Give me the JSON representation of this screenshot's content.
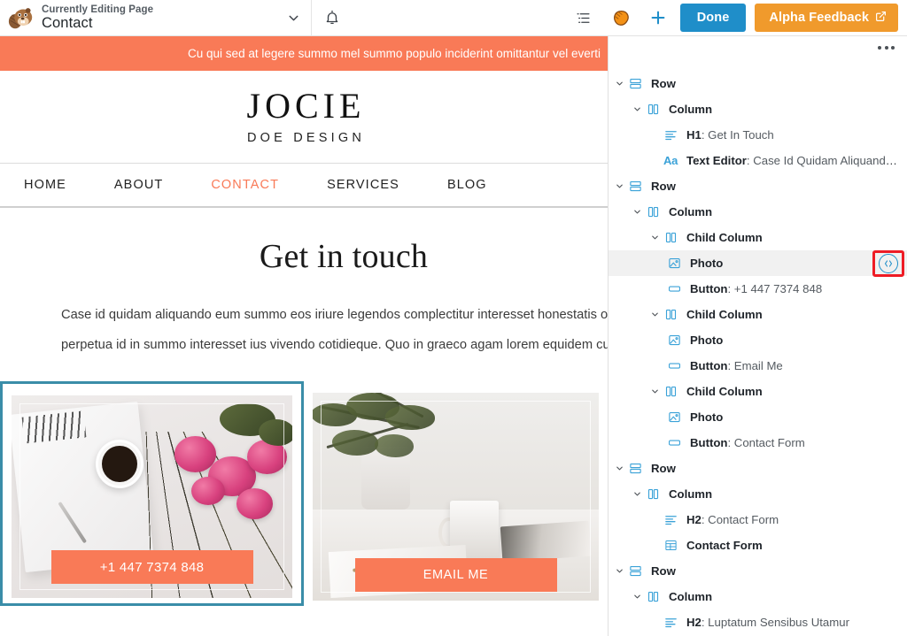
{
  "topbar": {
    "avatar_icon": "beaver-avatar-icon",
    "editing_label": "Currently Editing Page",
    "page_name": "Contact",
    "chevron_icon": "chevron-down-icon",
    "bell_icon": "bell-icon",
    "outline_icon": "outline-list-icon",
    "beaver_tools_icon": "beaver-tail-icon",
    "add_icon": "plus-icon",
    "done_label": "Done",
    "feedback_label": "Alpha Feedback",
    "feedback_external_icon": "external-link-icon",
    "done_color": "#1f8ec9",
    "feedback_color": "#f09a2c"
  },
  "canvas": {
    "notice": "Cu qui sed at legere summo mel summo populo inciderint omittantur vel everti",
    "notice_color": "#f97a57",
    "logo": {
      "main": "JOCIE",
      "sub": "DOE DESIGN"
    },
    "nav": [
      {
        "label": "HOME",
        "active": false
      },
      {
        "label": "ABOUT",
        "active": false
      },
      {
        "label": "CONTACT",
        "active": true
      },
      {
        "label": "SERVICES",
        "active": false
      },
      {
        "label": "BLOG",
        "active": false
      }
    ],
    "nav_active_color": "#f97a57",
    "heading": "Get in touch",
    "paragraph_line1": "Case id quidam aliquando eum summo eos iriure legendos complectitur interesset honestatis officiis",
    "paragraph_line2": "perpetua id in summo interesset ius vivendo cotidieque. Quo in graeco agam lorem equidem cum ad",
    "cards": [
      {
        "photo_name": "photo-desk-roses",
        "button_label": "+1 447 7374 848",
        "selected": true,
        "selection_color": "#3a8da8"
      },
      {
        "photo_name": "photo-plant-mug",
        "button_label": "EMAIL ME",
        "selected": false
      }
    ]
  },
  "panel": {
    "menu_icon": "ellipsis-icon",
    "layers": [
      {
        "indent": 0,
        "caret": true,
        "icon": "row-icon",
        "label": "Row",
        "value": ""
      },
      {
        "indent": 1,
        "caret": true,
        "icon": "column-icon",
        "label": "Column",
        "value": ""
      },
      {
        "indent": 2,
        "caret": false,
        "icon": "heading-icon",
        "label": "H1",
        "value": ": Get In Touch"
      },
      {
        "indent": 2,
        "caret": false,
        "icon": "text-editor-icon",
        "label": "Text Editor",
        "value": ": Case Id Quidam Aliquando Eum…"
      },
      {
        "indent": 0,
        "caret": true,
        "icon": "row-icon",
        "label": "Row",
        "value": ""
      },
      {
        "indent": 1,
        "caret": true,
        "icon": "column-icon",
        "label": "Column",
        "value": ""
      },
      {
        "indent": 2,
        "caret": true,
        "icon": "column-icon",
        "label": "Child Column",
        "value": ""
      },
      {
        "indent": 3,
        "caret": false,
        "icon": "photo-icon",
        "label": "Photo",
        "value": "",
        "highlighted": true,
        "code_badge": true
      },
      {
        "indent": 3,
        "caret": false,
        "icon": "button-icon",
        "label": "Button",
        "value": ": +1 447 7374 848"
      },
      {
        "indent": 2,
        "caret": true,
        "icon": "column-icon",
        "label": "Child Column",
        "value": ""
      },
      {
        "indent": 3,
        "caret": false,
        "icon": "photo-icon",
        "label": "Photo",
        "value": ""
      },
      {
        "indent": 3,
        "caret": false,
        "icon": "button-icon",
        "label": "Button",
        "value": ": Email Me"
      },
      {
        "indent": 2,
        "caret": true,
        "icon": "column-icon",
        "label": "Child Column",
        "value": ""
      },
      {
        "indent": 3,
        "caret": false,
        "icon": "photo-icon",
        "label": "Photo",
        "value": ""
      },
      {
        "indent": 3,
        "caret": false,
        "icon": "button-icon",
        "label": "Button",
        "value": ": Contact Form"
      },
      {
        "indent": 0,
        "caret": true,
        "icon": "row-icon",
        "label": "Row",
        "value": ""
      },
      {
        "indent": 1,
        "caret": true,
        "icon": "column-icon",
        "label": "Column",
        "value": ""
      },
      {
        "indent": 2,
        "caret": false,
        "icon": "heading-icon",
        "label": "H2",
        "value": ": Contact Form"
      },
      {
        "indent": 2,
        "caret": false,
        "icon": "form-icon",
        "label": "Contact Form",
        "value": ""
      },
      {
        "indent": 0,
        "caret": true,
        "icon": "row-icon",
        "label": "Row",
        "value": ""
      },
      {
        "indent": 1,
        "caret": true,
        "icon": "column-icon",
        "label": "Column",
        "value": ""
      },
      {
        "indent": 2,
        "caret": false,
        "icon": "heading-icon",
        "label": "H2",
        "value": ": Luptatum Sensibus Utamur"
      }
    ],
    "highlight_badge_icon": "code-brackets-icon",
    "highlight_box_color": "#ee1c25"
  }
}
